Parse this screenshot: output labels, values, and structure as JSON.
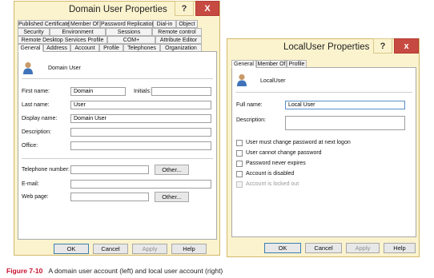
{
  "left_dialog": {
    "title": "Domain User Properties",
    "help_label": "?",
    "close_label": "X",
    "tabs_row1": [
      "Published Certificates",
      "Member Of",
      "Password Replication",
      "Dial-in",
      "Object"
    ],
    "tabs_row2": [
      "Security",
      "Environment",
      "Sessions",
      "Remote control"
    ],
    "tabs_row3": [
      "Remote Desktop Services Profile",
      "COM+",
      "Attribute Editor"
    ],
    "tabs_row4": [
      "General",
      "Address",
      "Account",
      "Profile",
      "Telephones",
      "Organization"
    ],
    "user_name": "Domain User",
    "first_name_label": "First name:",
    "first_name_value": "Domain",
    "initials_label": "Initials:",
    "initials_value": "",
    "last_name_label": "Last name:",
    "last_name_value": "User",
    "display_name_label": "Display name:",
    "display_name_value": "Domain User",
    "description_label": "Description:",
    "office_label": "Office:",
    "telephone_label": "Telephone number:",
    "other_label": "Other...",
    "email_label": "E-mail:",
    "webpage_label": "Web page:",
    "other2_label": "Other...",
    "ok": "OK",
    "cancel": "Cancel",
    "apply": "Apply",
    "help": "Help"
  },
  "right_dialog": {
    "title": "LocalUser Properties",
    "help_label": "?",
    "close_label": "x",
    "tabs": [
      "General",
      "Member Of",
      "Profile"
    ],
    "user_name": "LocalUser",
    "full_name_label": "Full name:",
    "full_name_value": "Local User",
    "description_label": "Description:",
    "checkboxes": [
      "User must change password at next logon",
      "User cannot change password",
      "Password never expires",
      "Account is disabled",
      "Account is locked out"
    ],
    "ok": "OK",
    "cancel": "Cancel",
    "apply": "Apply",
    "help": "Help"
  },
  "caption": {
    "figure": "Figure 7-10",
    "text": "A domain user account (left) and local user account (right)"
  }
}
